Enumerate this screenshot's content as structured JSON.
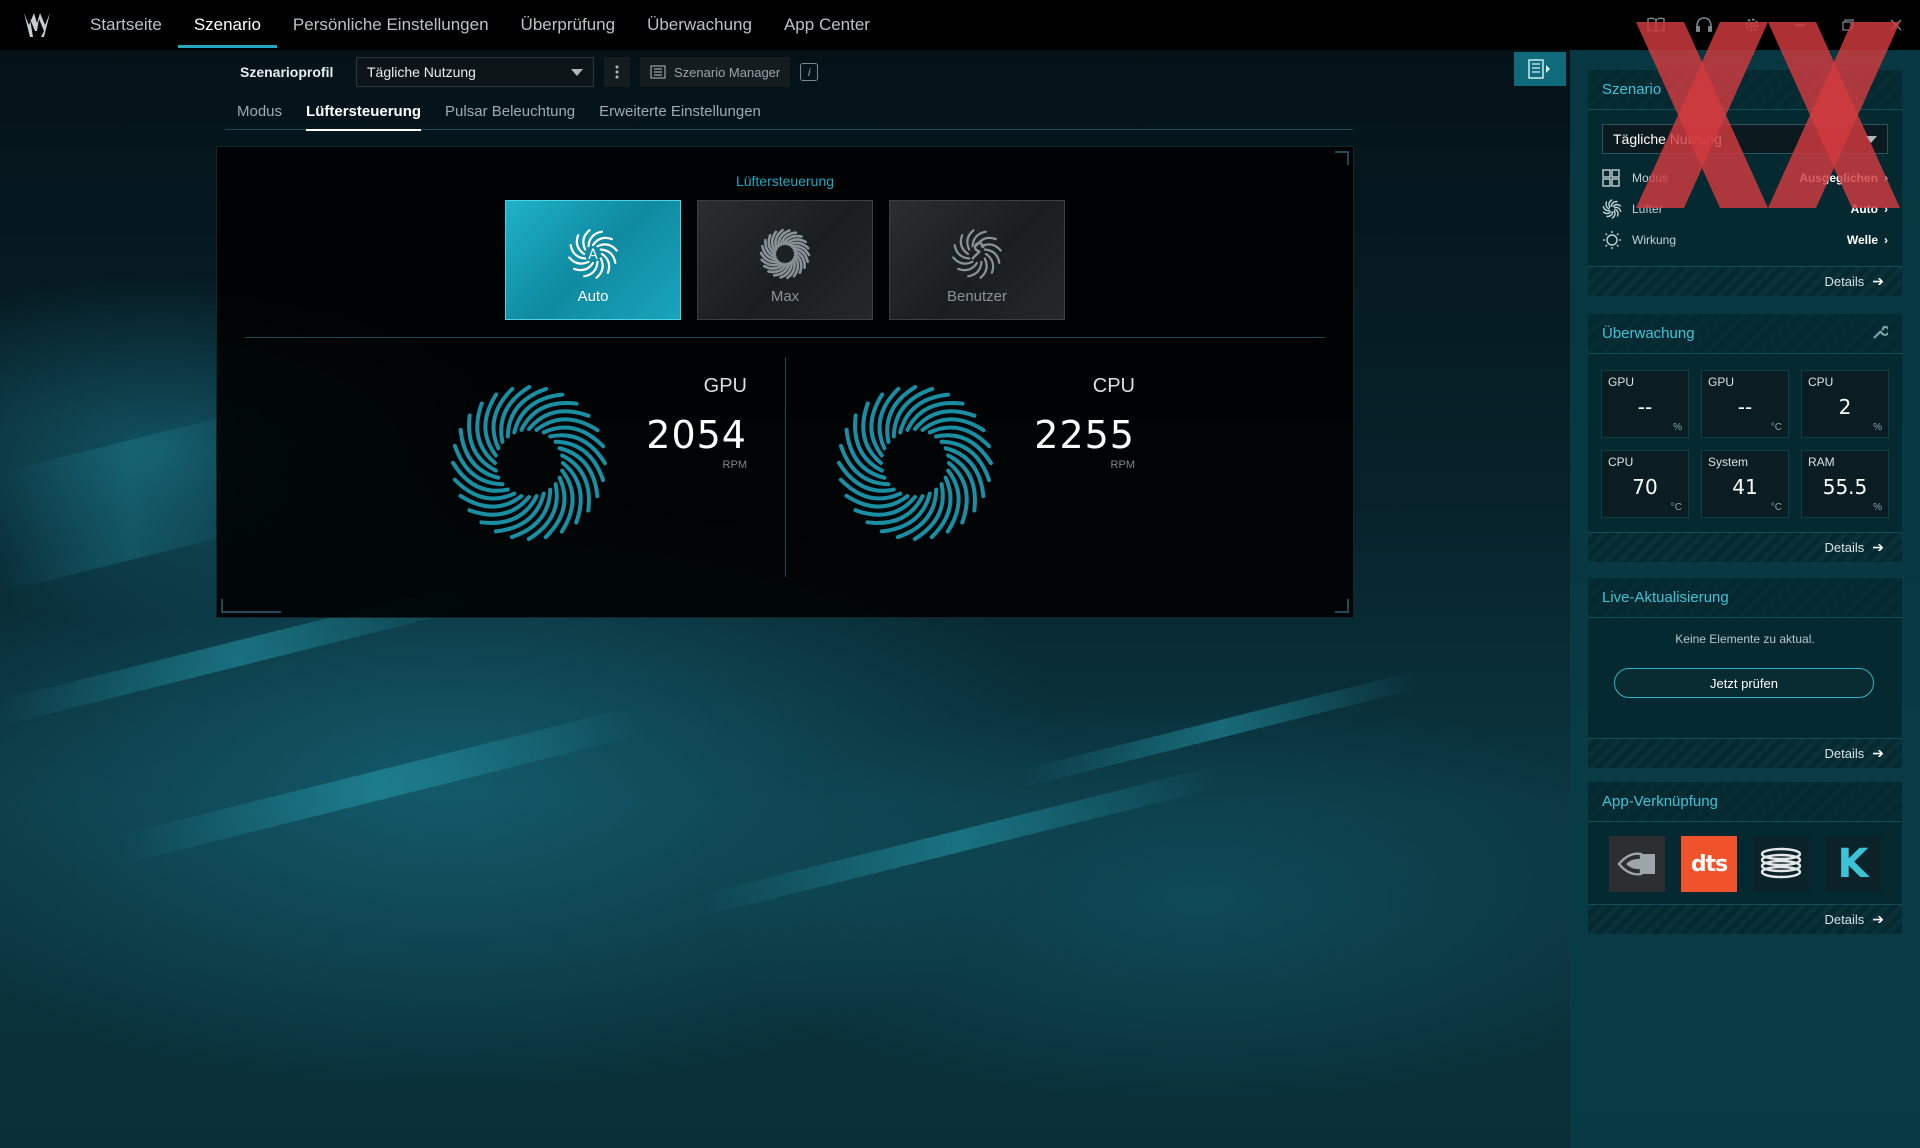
{
  "nav": {
    "items": [
      {
        "label": "Startseite",
        "active": false
      },
      {
        "label": "Szenario",
        "active": true
      },
      {
        "label": "Persönliche Einstellungen",
        "active": false
      },
      {
        "label": "Überprüfung",
        "active": false
      },
      {
        "label": "Überwachung",
        "active": false
      },
      {
        "label": "App Center",
        "active": false
      }
    ]
  },
  "profile": {
    "label": "Szenarioprofil",
    "selected": "Tägliche Nutzung",
    "manager_label": "Szenario Manager",
    "info_glyph": "i"
  },
  "subtabs": [
    {
      "label": "Modus",
      "active": false
    },
    {
      "label": "Lüftersteuerung",
      "active": true
    },
    {
      "label": "Pulsar Beleuchtung",
      "active": false
    },
    {
      "label": "Erweiterte Einstellungen",
      "active": false
    }
  ],
  "fan_control": {
    "title": "Lüftersteuerung",
    "modes": [
      {
        "label": "Auto",
        "active": true
      },
      {
        "label": "Max",
        "active": false
      },
      {
        "label": "Benutzer",
        "active": false
      }
    ],
    "fans": [
      {
        "name": "GPU",
        "rpm": "2054",
        "unit": "RPM"
      },
      {
        "name": "CPU",
        "rpm": "2255",
        "unit": "RPM"
      }
    ]
  },
  "sidebar": {
    "scenario": {
      "title": "Szenario",
      "selected": "Tägliche Nutzung",
      "rows": [
        {
          "label": "Modus",
          "value": "Ausgeglichen",
          "icon": "grid-icon"
        },
        {
          "label": "Lüfter",
          "value": "Auto",
          "icon": "fan-icon"
        },
        {
          "label": "Wirkung",
          "value": "Welle",
          "icon": "sun-icon"
        }
      ],
      "details": "Details"
    },
    "monitoring": {
      "title": "Überwachung",
      "tiles": [
        {
          "label": "GPU",
          "value": "--",
          "unit": "%"
        },
        {
          "label": "GPU",
          "value": "--",
          "unit": "°C"
        },
        {
          "label": "CPU",
          "value": "2",
          "unit": "%"
        },
        {
          "label": "CPU",
          "value": "70",
          "unit": "°C"
        },
        {
          "label": "System",
          "value": "41",
          "unit": "°C"
        },
        {
          "label": "RAM",
          "value": "55.5",
          "unit": "%"
        }
      ],
      "details": "Details"
    },
    "live_update": {
      "title": "Live-Aktualisierung",
      "message": "Keine Elemente zu aktual.",
      "button": "Jetzt prüfen",
      "details": "Details"
    },
    "app_links": {
      "title": "App-Verknüpfung",
      "apps": [
        {
          "name": "nvidia-icon",
          "bg": "#2b2f31"
        },
        {
          "name": "dts",
          "label": "dts",
          "bg": "#f0532b"
        },
        {
          "name": "stack-icon",
          "bg": "#0b2228"
        },
        {
          "name": "killer-icon",
          "label": "K",
          "bg": "#0b2228"
        }
      ],
      "details": "Details"
    }
  },
  "colors": {
    "accent": "#1fa8c0",
    "sidebar_bg": "#083c46",
    "active_mode": "#16a2b9",
    "watermark": "#d23a3f"
  }
}
